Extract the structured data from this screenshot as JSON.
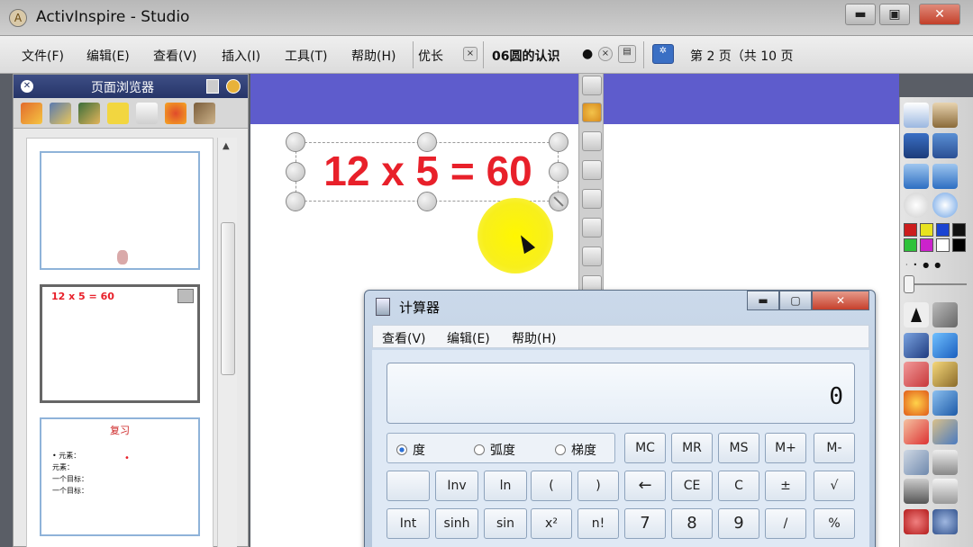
{
  "window": {
    "title": "ActivInspire - Studio",
    "logo_letter": "A"
  },
  "menubar": {
    "items": [
      "文件(F)",
      "编辑(E)",
      "查看(V)",
      "插入(I)",
      "工具(T)",
      "帮助(H)"
    ],
    "profile_label": "优长",
    "doc_title": "06圆的认识",
    "page_indicator": "第 2 页（共 10 页"
  },
  "page_browser": {
    "title": "页面浏览器",
    "thumbs": [
      {
        "text": ""
      },
      {
        "text": "12 x 5 = 60"
      },
      {
        "title": "复习",
        "lines": [
          "• 元素：",
          "   元素：",
          "   一个目标：",
          "   一个目标："
        ]
      }
    ]
  },
  "canvas": {
    "equation": "12 x 5 = 60",
    "band_color": "#5e5ccc",
    "eq_color": "#e8202a"
  },
  "calculator": {
    "title": "计算器",
    "menu": [
      "查看(V)",
      "编辑(E)",
      "帮助(H)"
    ],
    "display_value": "0",
    "angle_modes": [
      {
        "label": "度",
        "selected": true
      },
      {
        "label": "弧度",
        "selected": false
      },
      {
        "label": "梯度",
        "selected": false
      }
    ],
    "memory_keys": [
      "MC",
      "MR",
      "MS",
      "M+",
      "M-"
    ],
    "row2": [
      "",
      "Inv",
      "ln",
      "(",
      ")",
      "←",
      "CE",
      "C",
      "±",
      "√"
    ],
    "row3": [
      "Int",
      "sinh",
      "sin",
      "x²",
      "n!",
      "7",
      "8",
      "9",
      "/",
      "%"
    ]
  },
  "toolbox": {
    "swatches": [
      "#cc1d1d",
      "#e8e21f",
      "#1b44d2",
      "#111111",
      "#2ec23a",
      "#cc22cc",
      "#ffffff",
      "#000000"
    ]
  }
}
